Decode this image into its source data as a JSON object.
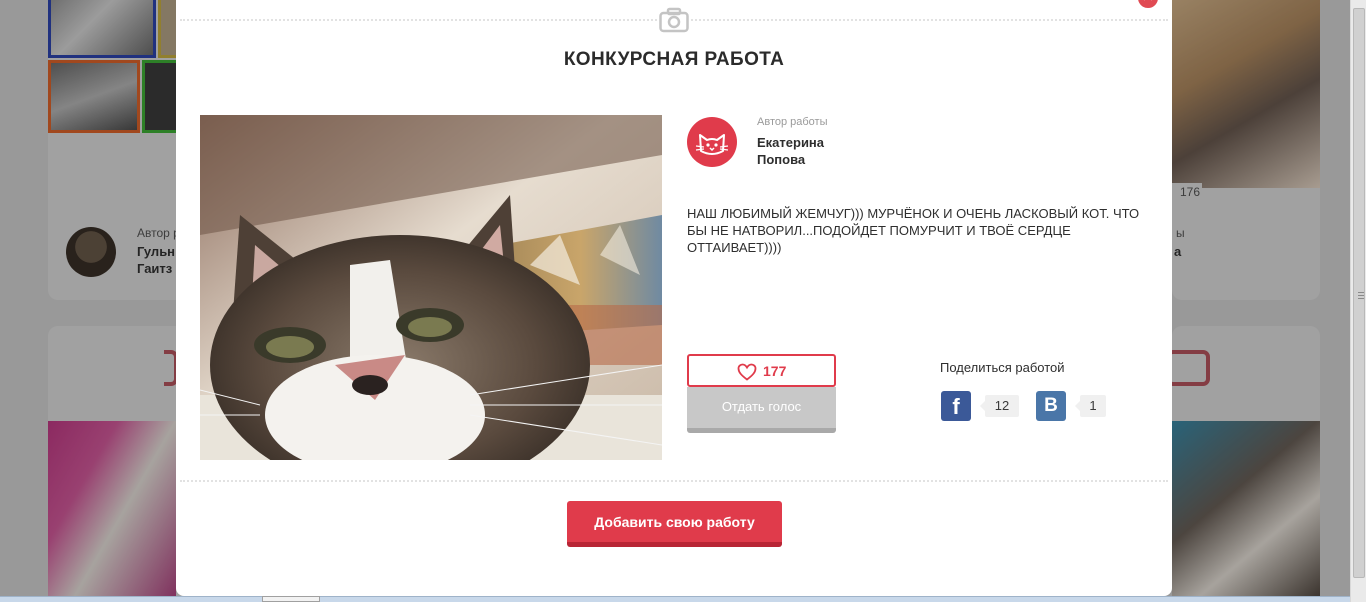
{
  "modal": {
    "title": "КОНКУРСНАЯ РАБОТА",
    "close_symbol": "✕",
    "author": {
      "caption": "Автор работы",
      "first_name": "Екатерина",
      "last_name": "Попова",
      "avatar_icon": "cat-face-icon"
    },
    "description": "НАШ ЛЮБИМЫЙ ЖЕМЧУГ))) МУРЧЁНОК И ОЧЕНЬ ЛАСКОВЫЙ КОТ. ЧТО БЫ НЕ НАТВОРИЛ...ПОДОЙДЕТ ПОМУРЧИТ И ТВОЁ СЕРДЦЕ ОТТАИВАЕТ))))",
    "likes": "177",
    "vote_label": "Отдать голос",
    "share": {
      "label": "Поделиться работой",
      "facebook": {
        "icon": "f",
        "count": "12"
      },
      "vk": {
        "icon": "В",
        "count": "1"
      }
    },
    "add_button_label": "Добавить свою работу"
  },
  "background": {
    "left_card": {
      "author_caption": "Автор р",
      "name_line1": "Гульн",
      "name_line2": "Гаитз"
    },
    "right_card": {
      "votes": "176",
      "caption_fragment": "ы",
      "name_fragment": "а"
    }
  },
  "colors": {
    "accent": "#e03b4b",
    "accent_dark": "#b82535",
    "facebook": "#3b5998",
    "vk": "#4a76a8",
    "vote_disabled": "#c8c8c8"
  }
}
